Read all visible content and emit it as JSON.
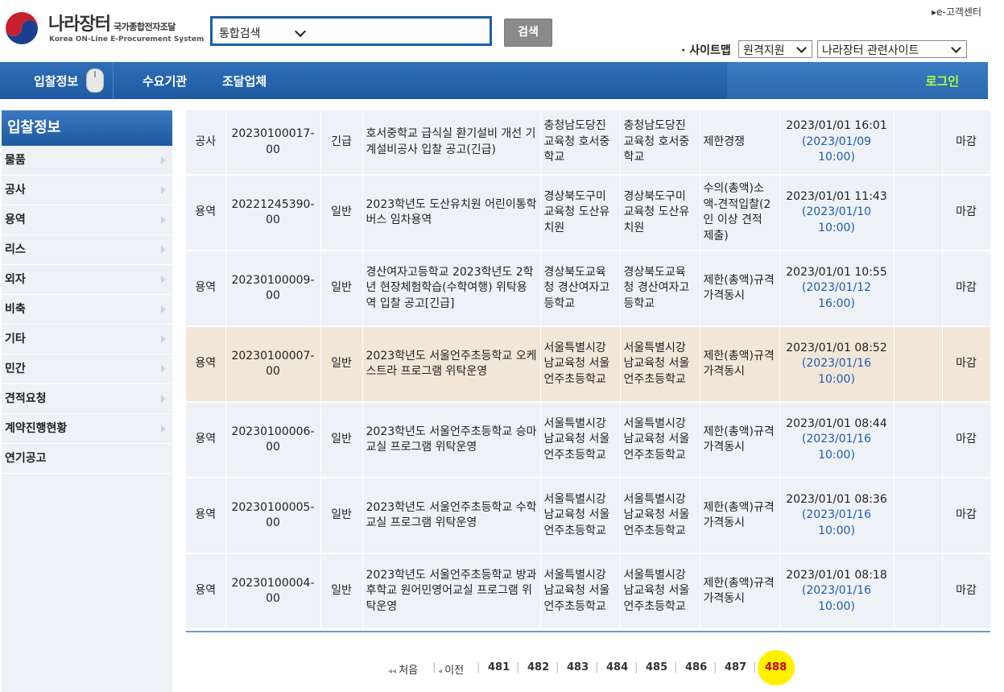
{
  "header": {
    "logo_title": "나라장터",
    "logo_subtitle": "국가종합전자조달",
    "logo_en": "Korea ON-Line E-Procurement System",
    "customer_center": "e-고객센터",
    "search_scope": "통합검색",
    "search_button": "검색",
    "sitemap_label": "· 사이트맵",
    "select_remote": "원격지원",
    "select_related": "나라장터 관련사이트"
  },
  "nav": {
    "items": [
      "입찰정보",
      "수요기관",
      "조달업체"
    ],
    "login": "로그인"
  },
  "sidebar": {
    "title": "입찰정보",
    "items": [
      {
        "label": "물품",
        "has_arrow": true
      },
      {
        "label": "공사",
        "has_arrow": true
      },
      {
        "label": "용역",
        "has_arrow": true
      },
      {
        "label": "리스",
        "has_arrow": true
      },
      {
        "label": "외자",
        "has_arrow": true
      },
      {
        "label": "비축",
        "has_arrow": true
      },
      {
        "label": "기타",
        "has_arrow": true
      },
      {
        "label": "민간",
        "has_arrow": true
      },
      {
        "label": "견적요청",
        "has_arrow": true
      },
      {
        "label": "계약진행현황",
        "has_arrow": true
      },
      {
        "label": "연기공고",
        "has_arrow": false
      }
    ]
  },
  "rows": [
    {
      "type": "공사",
      "bid_no": "20230100017-00",
      "kind": "긴급",
      "title": "호서중학교 급식실 환기설비 개선 기계설비공사 입찰 공고(긴급)",
      "notice_org": "충청남도당진교육청 호서중학교",
      "demand_org": "충청남도당진교육청 호서중학교",
      "contract": "제한경쟁",
      "date": "2023/01/01 16:01",
      "deadline": "(2023/01/09 10:00)",
      "status": "마감",
      "highlight": false
    },
    {
      "type": "용역",
      "bid_no": "20221245390-00",
      "kind": "일반",
      "title": "2023학년도 도산유치원 어린이통학버스 임차용역",
      "notice_org": "경상북도구미교육청 도산유치원",
      "demand_org": "경상북도구미교육청 도산유치원",
      "contract": "수의(총액)소액-견적입찰(2인 이상 견적 제출)",
      "date": "2023/01/01 11:43",
      "deadline": "(2023/01/10 10:00)",
      "status": "마감",
      "highlight": false
    },
    {
      "type": "용역",
      "bid_no": "20230100009-00",
      "kind": "일반",
      "title": "경산여자고등학교 2023학년도 2학년 현장체험학습(수학여행) 위탁용역 입찰 공고[긴급]",
      "notice_org": "경상북도교육청 경산여자고등학교",
      "demand_org": "경상북도교육청 경산여자고등학교",
      "contract": "제한(총액)규격가격동시",
      "date": "2023/01/01 10:55",
      "deadline": "(2023/01/12 16:00)",
      "status": "마감",
      "highlight": false
    },
    {
      "type": "용역",
      "bid_no": "20230100007-00",
      "kind": "일반",
      "title": "2023학년도 서울언주초등학교 오케스트라 프로그램 위탁운영",
      "notice_org": "서울특별시강남교육청 서울언주초등학교",
      "demand_org": "서울특별시강남교육청 서울언주초등학교",
      "contract": "제한(총액)규격가격동시",
      "date": "2023/01/01 08:52",
      "deadline": "(2023/01/16 10:00)",
      "status": "마감",
      "highlight": true
    },
    {
      "type": "용역",
      "bid_no": "20230100006-00",
      "kind": "일반",
      "title": "2023학년도 서울언주초등학교 승마교실 프로그램 위탁운영",
      "notice_org": "서울특별시강남교육청 서울언주초등학교",
      "demand_org": "서울특별시강남교육청 서울언주초등학교",
      "contract": "제한(총액)규격가격동시",
      "date": "2023/01/01 08:44",
      "deadline": "(2023/01/16 10:00)",
      "status": "마감",
      "highlight": false
    },
    {
      "type": "용역",
      "bid_no": "20230100005-00",
      "kind": "일반",
      "title": "2023학년도 서울언주초등학교 수학교실 프로그램 위탁운영",
      "notice_org": "서울특별시강남교육청 서울언주초등학교",
      "demand_org": "서울특별시강남교육청 서울언주초등학교",
      "contract": "제한(총액)규격가격동시",
      "date": "2023/01/01 08:36",
      "deadline": "(2023/01/16 10:00)",
      "status": "마감",
      "highlight": false
    },
    {
      "type": "용역",
      "bid_no": "20230100004-00",
      "kind": "일반",
      "title": "2023학년도 서울언주초등학교 방과후학교 원어민영어교실 프로그램 위탁운영",
      "notice_org": "서울특별시강남교육청 서울언주초등학교",
      "demand_org": "서울특별시강남교육청 서울언주초등학교",
      "contract": "제한(총액)규격가격동시",
      "date": "2023/01/01 08:18",
      "deadline": "(2023/01/16 10:00)",
      "status": "마감",
      "highlight": false
    }
  ],
  "paging": {
    "first": "처음",
    "prev": "이전",
    "pages": [
      "481",
      "482",
      "483",
      "484",
      "485",
      "486",
      "487"
    ],
    "current": "488"
  },
  "colors": {
    "brand_blue": "#1e5aa0",
    "link": "#1d5cb0",
    "login": "#b6ff3d",
    "highlight_row": "#f2e6d8",
    "current_page": "#cc0000",
    "marker": "#fff100"
  }
}
